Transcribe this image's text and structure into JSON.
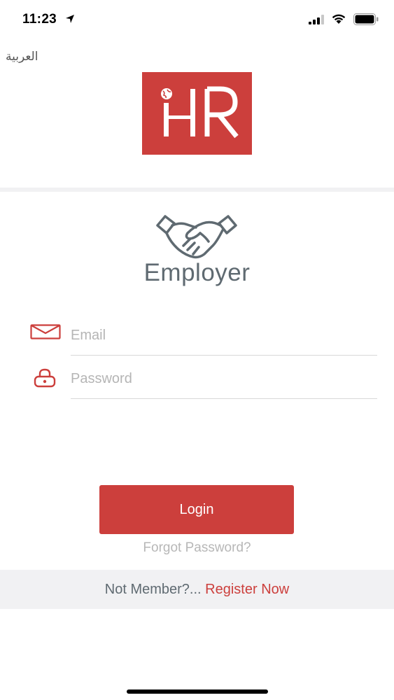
{
  "status_bar": {
    "time": "11:23",
    "icons": [
      "location-arrow-icon",
      "cellular-signal-icon",
      "wifi-icon",
      "battery-icon"
    ]
  },
  "language_toggle": "العربية",
  "logo": {
    "text": "iHR",
    "background_color": "#cc3f3c",
    "globe_icon": "globe-icon"
  },
  "role": {
    "icon": "handshake-icon",
    "title": "Employer"
  },
  "form": {
    "email": {
      "icon": "mail-icon",
      "placeholder": "Email",
      "value": ""
    },
    "password": {
      "icon": "lock-icon",
      "placeholder": "Password",
      "value": ""
    }
  },
  "login_button": "Login",
  "forgot_password": "Forgot Password?",
  "register": {
    "prompt": "Not Member?...",
    "link": "Register Now"
  },
  "colors": {
    "accent": "#cc3f3c",
    "title_gray": "#5f6a71",
    "placeholder_gray": "#b5b5b5",
    "strip_background": "#f1f1f3"
  }
}
